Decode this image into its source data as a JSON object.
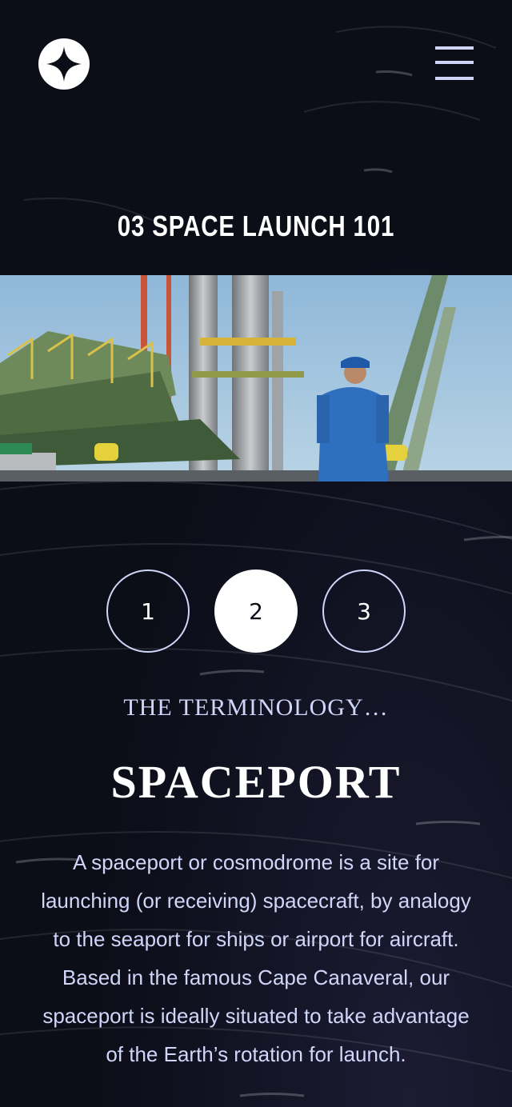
{
  "header": {
    "logo_icon": "star-logo-icon",
    "menu_icon": "hamburger-menu-icon"
  },
  "page_title": {
    "number": "03",
    "text": "SPACE LAUNCH 101"
  },
  "hero_image": {
    "subject": "launch-vehicle-photo"
  },
  "pager": {
    "items": [
      {
        "label": "1",
        "active": false
      },
      {
        "label": "2",
        "active": true
      },
      {
        "label": "3",
        "active": false
      }
    ]
  },
  "content": {
    "eyebrow": "THE TERMINOLOGY…",
    "heading": "SPACEPORT",
    "description": "A spaceport or cosmodrome is a site for launching (or receiving) spacecraft, by analogy to the seaport for ships or airport for aircraft. Based in the famous Cape Canaveral, our spaceport is ideally situated to take advantage of the Earth’s rotation for launch."
  },
  "colors": {
    "background": "#0b0d17",
    "accent": "#d0d6f9",
    "white": "#ffffff"
  }
}
